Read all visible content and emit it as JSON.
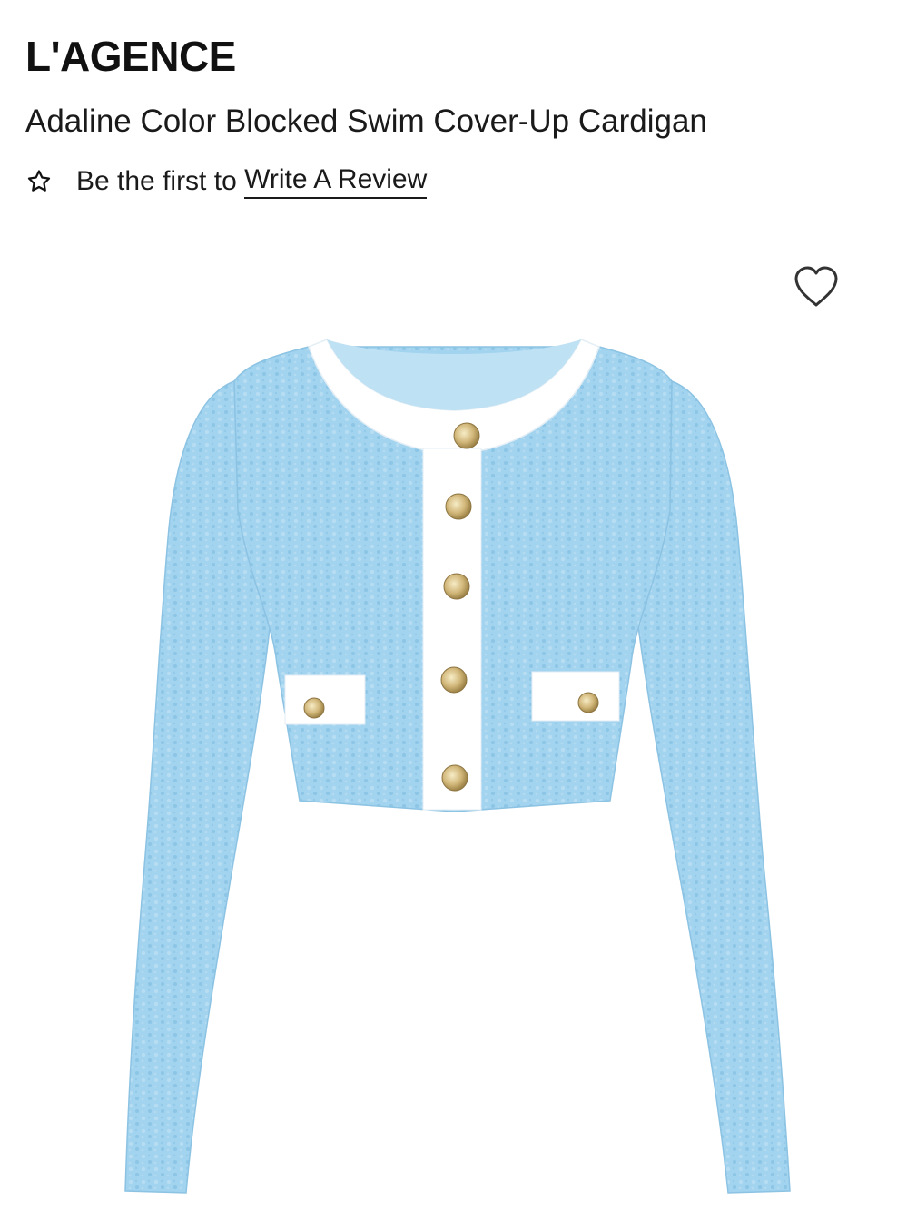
{
  "product": {
    "brand": "L'AGENCE",
    "title": "Adaline Color Blocked Swim Cover-Up Cardigan"
  },
  "reviews": {
    "prompt": "Be the first to ",
    "link_label": "Write A Review",
    "star_icon": "star-outline-icon"
  },
  "gallery": {
    "wishlist_icon": "heart-outline-icon",
    "image_subject": "light-blue-cropped-cardigan"
  },
  "colors": {
    "fabric": "#9fd2ef",
    "trim": "#ffffff",
    "buttons": "#d8c28a",
    "text": "#111111"
  }
}
